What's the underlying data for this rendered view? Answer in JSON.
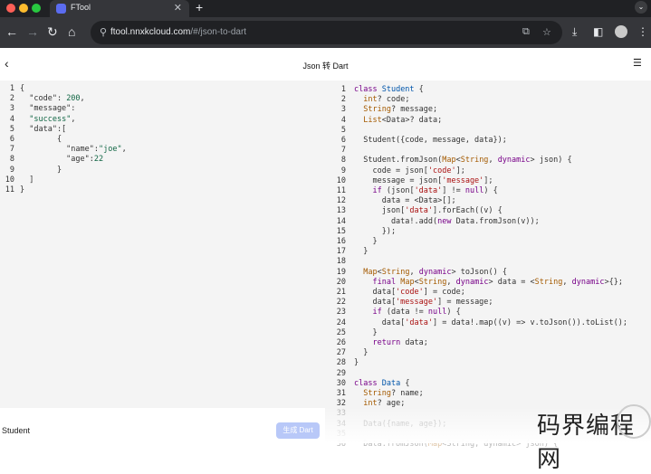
{
  "browser": {
    "tab_title": "FTool",
    "url_host": "ftool.nnxkcloud.com",
    "url_path": "/#/json-to-dart",
    "new_tab_label": "+",
    "tab_close_label": "✕",
    "colors": {
      "red": "#ff5f57",
      "yellow": "#febc2e",
      "green": "#28c840"
    }
  },
  "app": {
    "title": "Json 转 Dart",
    "bottom_label": "Student",
    "generate_button": "生成 Dart"
  },
  "left_editor": {
    "lines": [
      {
        "n": "1",
        "c": [
          {
            "t": "{",
            "k": "p"
          }
        ]
      },
      {
        "n": "2",
        "c": [
          {
            "t": "  \"code\": ",
            "k": "p"
          },
          {
            "t": "200",
            "k": "d"
          },
          {
            "t": ",",
            "k": "p"
          }
        ]
      },
      {
        "n": "3",
        "c": [
          {
            "t": "  \"message\":",
            "k": "p"
          }
        ]
      },
      {
        "n": "4",
        "c": [
          {
            "t": "  ",
            "k": "p"
          },
          {
            "t": "\"success\"",
            "k": "d"
          },
          {
            "t": ",",
            "k": "p"
          }
        ]
      },
      {
        "n": "5",
        "c": [
          {
            "t": "  \"data\":[",
            "k": "p"
          }
        ]
      },
      {
        "n": "6",
        "c": [
          {
            "t": "        {",
            "k": "p"
          }
        ]
      },
      {
        "n": "7",
        "c": [
          {
            "t": "          \"name\":",
            "k": "p"
          },
          {
            "t": "\"joe\"",
            "k": "d"
          },
          {
            "t": ",",
            "k": "p"
          }
        ]
      },
      {
        "n": "8",
        "c": [
          {
            "t": "          \"age\":",
            "k": "p"
          },
          {
            "t": "22",
            "k": "d"
          }
        ]
      },
      {
        "n": "9",
        "c": [
          {
            "t": "        }",
            "k": "p"
          }
        ]
      },
      {
        "n": "10",
        "c": [
          {
            "t": "  ]",
            "k": "p"
          }
        ]
      },
      {
        "n": "11",
        "c": [
          {
            "t": "}",
            "k": "p"
          }
        ]
      }
    ]
  },
  "right_editor": {
    "lines": [
      {
        "n": "1",
        "c": [
          {
            "t": "class ",
            "k": "k"
          },
          {
            "t": "Student",
            "k": "v"
          },
          {
            "t": " {",
            "k": "p"
          }
        ]
      },
      {
        "n": "2",
        "c": [
          {
            "t": "  ",
            "k": "p"
          },
          {
            "t": "int",
            "k": "t"
          },
          {
            "t": "? code;",
            "k": "p"
          }
        ]
      },
      {
        "n": "3",
        "c": [
          {
            "t": "  ",
            "k": "p"
          },
          {
            "t": "String",
            "k": "t"
          },
          {
            "t": "? message;",
            "k": "p"
          }
        ]
      },
      {
        "n": "4",
        "c": [
          {
            "t": "  ",
            "k": "p"
          },
          {
            "t": "List",
            "k": "t"
          },
          {
            "t": "<Data>? data;",
            "k": "p"
          }
        ]
      },
      {
        "n": "5",
        "c": []
      },
      {
        "n": "6",
        "c": [
          {
            "t": "  Student({code, message, data});",
            "k": "p"
          }
        ]
      },
      {
        "n": "7",
        "c": []
      },
      {
        "n": "8",
        "c": [
          {
            "t": "  Student.fromJson(",
            "k": "p"
          },
          {
            "t": "Map",
            "k": "t"
          },
          {
            "t": "<",
            "k": "p"
          },
          {
            "t": "String",
            "k": "t"
          },
          {
            "t": ", ",
            "k": "p"
          },
          {
            "t": "dynamic",
            "k": "k"
          },
          {
            "t": "> json) {",
            "k": "p"
          }
        ]
      },
      {
        "n": "9",
        "c": [
          {
            "t": "    code = json[",
            "k": "p"
          },
          {
            "t": "'code'",
            "k": "s"
          },
          {
            "t": "];",
            "k": "p"
          }
        ]
      },
      {
        "n": "10",
        "c": [
          {
            "t": "    message = json[",
            "k": "p"
          },
          {
            "t": "'message'",
            "k": "s"
          },
          {
            "t": "];",
            "k": "p"
          }
        ]
      },
      {
        "n": "11",
        "c": [
          {
            "t": "    ",
            "k": "p"
          },
          {
            "t": "if",
            "k": "k"
          },
          {
            "t": " (json[",
            "k": "p"
          },
          {
            "t": "'data'",
            "k": "s"
          },
          {
            "t": "] != ",
            "k": "p"
          },
          {
            "t": "null",
            "k": "k"
          },
          {
            "t": ") {",
            "k": "p"
          }
        ]
      },
      {
        "n": "12",
        "c": [
          {
            "t": "      data = <Data>[];",
            "k": "p"
          }
        ]
      },
      {
        "n": "13",
        "c": [
          {
            "t": "      json[",
            "k": "p"
          },
          {
            "t": "'data'",
            "k": "s"
          },
          {
            "t": "].forEach((v) {",
            "k": "p"
          }
        ]
      },
      {
        "n": "14",
        "c": [
          {
            "t": "        data!.add(",
            "k": "p"
          },
          {
            "t": "new",
            "k": "k"
          },
          {
            "t": " Data.fromJson(v));",
            "k": "p"
          }
        ]
      },
      {
        "n": "15",
        "c": [
          {
            "t": "      });",
            "k": "p"
          }
        ]
      },
      {
        "n": "16",
        "c": [
          {
            "t": "    }",
            "k": "p"
          }
        ]
      },
      {
        "n": "17",
        "c": [
          {
            "t": "  }",
            "k": "p"
          }
        ]
      },
      {
        "n": "18",
        "c": []
      },
      {
        "n": "19",
        "c": [
          {
            "t": "  ",
            "k": "p"
          },
          {
            "t": "Map",
            "k": "t"
          },
          {
            "t": "<",
            "k": "p"
          },
          {
            "t": "String",
            "k": "t"
          },
          {
            "t": ", ",
            "k": "p"
          },
          {
            "t": "dynamic",
            "k": "k"
          },
          {
            "t": "> toJson() {",
            "k": "p"
          }
        ]
      },
      {
        "n": "20",
        "c": [
          {
            "t": "    ",
            "k": "p"
          },
          {
            "t": "final",
            "k": "k"
          },
          {
            "t": " ",
            "k": "p"
          },
          {
            "t": "Map",
            "k": "t"
          },
          {
            "t": "<",
            "k": "p"
          },
          {
            "t": "String",
            "k": "t"
          },
          {
            "t": ", ",
            "k": "p"
          },
          {
            "t": "dynamic",
            "k": "k"
          },
          {
            "t": "> data = <",
            "k": "p"
          },
          {
            "t": "String",
            "k": "t"
          },
          {
            "t": ", ",
            "k": "p"
          },
          {
            "t": "dynamic",
            "k": "k"
          },
          {
            "t": ">{};",
            "k": "p"
          }
        ]
      },
      {
        "n": "21",
        "c": [
          {
            "t": "    data[",
            "k": "p"
          },
          {
            "t": "'code'",
            "k": "s"
          },
          {
            "t": "] = code;",
            "k": "p"
          }
        ]
      },
      {
        "n": "22",
        "c": [
          {
            "t": "    data[",
            "k": "p"
          },
          {
            "t": "'message'",
            "k": "s"
          },
          {
            "t": "] = message;",
            "k": "p"
          }
        ]
      },
      {
        "n": "23",
        "c": [
          {
            "t": "    ",
            "k": "p"
          },
          {
            "t": "if",
            "k": "k"
          },
          {
            "t": " (data != ",
            "k": "p"
          },
          {
            "t": "null",
            "k": "k"
          },
          {
            "t": ") {",
            "k": "p"
          }
        ]
      },
      {
        "n": "24",
        "c": [
          {
            "t": "      data[",
            "k": "p"
          },
          {
            "t": "'data'",
            "k": "s"
          },
          {
            "t": "] = data!.map((v) => v.toJson()).toList();",
            "k": "p"
          }
        ]
      },
      {
        "n": "25",
        "c": [
          {
            "t": "    }",
            "k": "p"
          }
        ]
      },
      {
        "n": "26",
        "c": [
          {
            "t": "    ",
            "k": "p"
          },
          {
            "t": "return",
            "k": "k"
          },
          {
            "t": " data;",
            "k": "p"
          }
        ]
      },
      {
        "n": "27",
        "c": [
          {
            "t": "  }",
            "k": "p"
          }
        ]
      },
      {
        "n": "28",
        "c": [
          {
            "t": "}",
            "k": "p"
          }
        ]
      },
      {
        "n": "29",
        "c": []
      },
      {
        "n": "30",
        "c": [
          {
            "t": "class ",
            "k": "k"
          },
          {
            "t": "Data",
            "k": "v"
          },
          {
            "t": " {",
            "k": "p"
          }
        ]
      },
      {
        "n": "31",
        "c": [
          {
            "t": "  ",
            "k": "p"
          },
          {
            "t": "String",
            "k": "t"
          },
          {
            "t": "? name;",
            "k": "p"
          }
        ]
      },
      {
        "n": "32",
        "c": [
          {
            "t": "  ",
            "k": "p"
          },
          {
            "t": "int",
            "k": "t"
          },
          {
            "t": "? age;",
            "k": "p"
          }
        ]
      },
      {
        "n": "33",
        "c": []
      },
      {
        "n": "34",
        "c": [
          {
            "t": "  Data({name, age});",
            "k": "p"
          }
        ]
      },
      {
        "n": "35",
        "c": []
      },
      {
        "n": "36",
        "c": [
          {
            "t": "  Data.fromJson(",
            "k": "p"
          },
          {
            "t": "Map",
            "k": "t"
          },
          {
            "t": "<String, dynamic> json) {",
            "k": "p"
          }
        ]
      }
    ]
  },
  "watermark": "码界编程网"
}
